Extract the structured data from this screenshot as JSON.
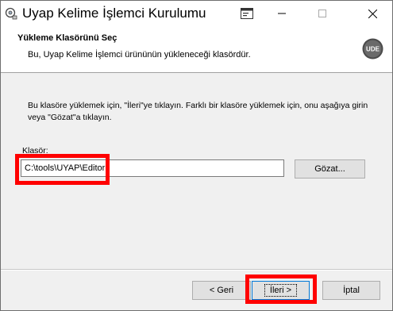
{
  "window": {
    "title": "Uyap Kelime İşlemci Kurulumu"
  },
  "header": {
    "title": "Yükleme Klasörünü Seç",
    "subtitle": "Bu, Uyap Kelime İşlemci ürününün yükleneceği klasördür.",
    "logo_text": "UDE"
  },
  "body": {
    "instruction": "Bu klasöre yüklemek için, \"İleri\"ye tıklayın. Farklı bir klasöre yüklemek için, onu aşağıya girin veya \"Gözat\"a tıklayın.",
    "folder_label": "Klasör:",
    "folder_value": "C:\\tools\\UYAP\\Editor",
    "browse_label": "Gözat..."
  },
  "footer": {
    "back_label": "< Geri",
    "next_label": "İleri >",
    "cancel_label": "İptal"
  },
  "icons": {
    "app": "setup-icon",
    "system": "system-menu-icon",
    "minimize": "minimize-icon",
    "maximize": "maximize-icon",
    "close": "close-icon"
  },
  "colors": {
    "highlight": "#ff0000",
    "focus_border": "#0078d7"
  }
}
